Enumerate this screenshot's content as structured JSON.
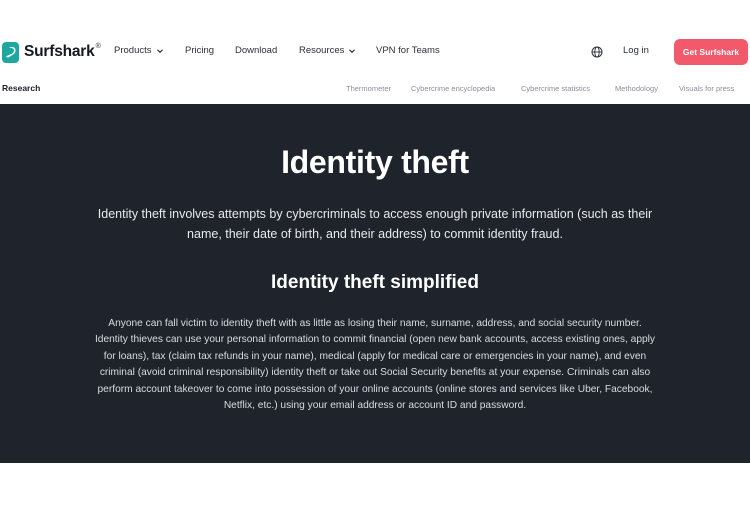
{
  "brand": {
    "name": "Surfshark",
    "reg_mark": "®",
    "accent": "#f25a6b",
    "logo_color": "#1ea7a0"
  },
  "nav": {
    "items": [
      {
        "label": "Products",
        "dropdown": true
      },
      {
        "label": "Pricing",
        "dropdown": false
      },
      {
        "label": "Download",
        "dropdown": false
      },
      {
        "label": "Resources",
        "dropdown": true
      },
      {
        "label": "VPN for Teams",
        "dropdown": false
      }
    ],
    "language_icon": "globe-icon",
    "login": "Log in",
    "cta": "Get Surfshark"
  },
  "subnav": {
    "title": "Research",
    "links": [
      "Thermometer",
      "Cybercrime encyclopedia",
      "Cybercrime statistics",
      "Methodology",
      "Visuals for press"
    ]
  },
  "hero": {
    "background": "#1f232b",
    "title": "Identity theft",
    "intro_line1": "Identity theft involves attempts by cybercriminals to access enough private information (such as their",
    "intro_line2": "name, their date of birth, and their address) to commit identity fraud.",
    "subtitle": "Identity theft simplified",
    "body": [
      "Anyone can fall victim to identity theft with as little as losing their name, surname, address, and social security number.",
      "Identity thieves can use your personal information to commit financial (open new bank accounts, access existing ones, apply",
      "for loans), tax (claim tax refunds in your name), medical (apply for medical care or emergencies in your name), and even",
      "criminal (avoid criminal responsibility) identity theft or take out Social Security benefits at your expense. Criminals can also",
      "perform account takeover to come into possession of your online accounts (online stores and services like Uber, Facebook,",
      "Netflix, etc.) using your email address or account ID and password."
    ]
  }
}
